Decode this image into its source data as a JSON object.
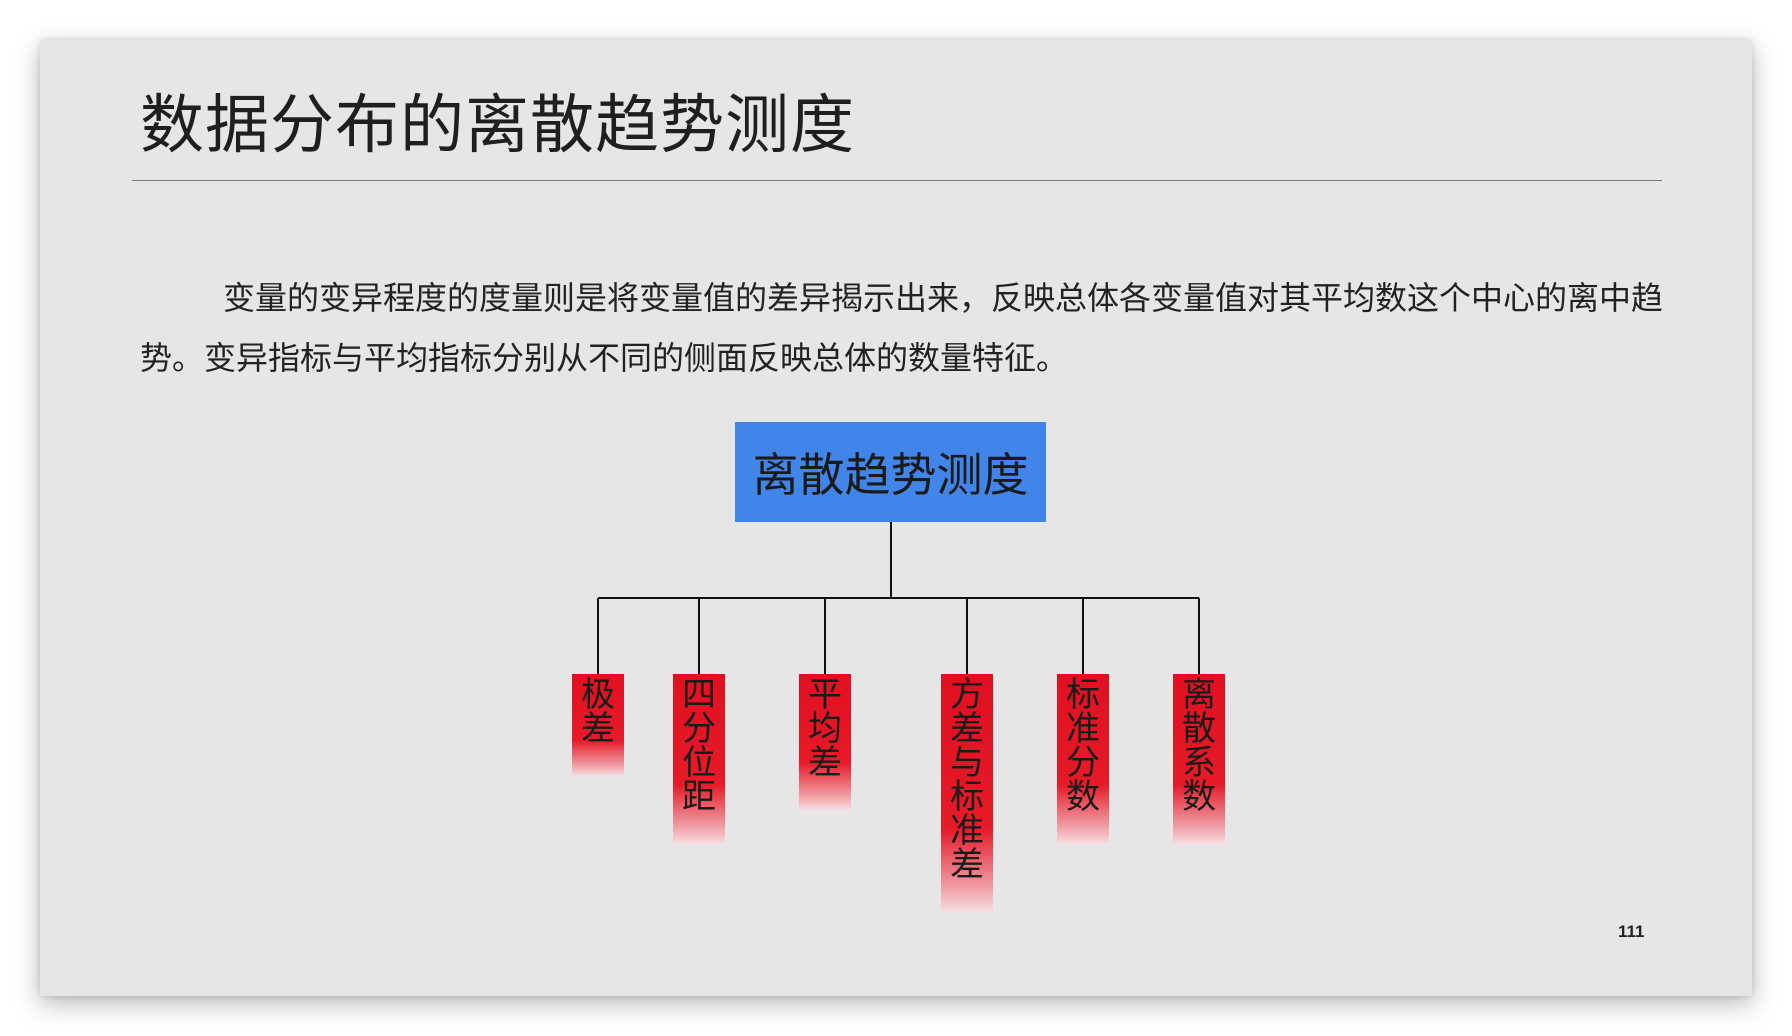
{
  "slide": {
    "title": "数据分布的离散趋势测度",
    "paragraph": "变量的变异程度的度量则是将变量值的差异揭示出来，反映总体各变量值对其平均数这个中心的离中趋势。变异指标与平均指标分别从不同的侧面反映总体的数量特征。",
    "page_number": "111"
  },
  "diagram": {
    "root": {
      "label": "离散趋势测度",
      "color": "#4185e8"
    },
    "leaf_color": "#e01020",
    "leaves": [
      {
        "label": "极差"
      },
      {
        "label": "四分位距"
      },
      {
        "label": "平均差"
      },
      {
        "label": "方差与标准差"
      },
      {
        "label": "标准分数"
      },
      {
        "label": "离散系数"
      }
    ]
  }
}
